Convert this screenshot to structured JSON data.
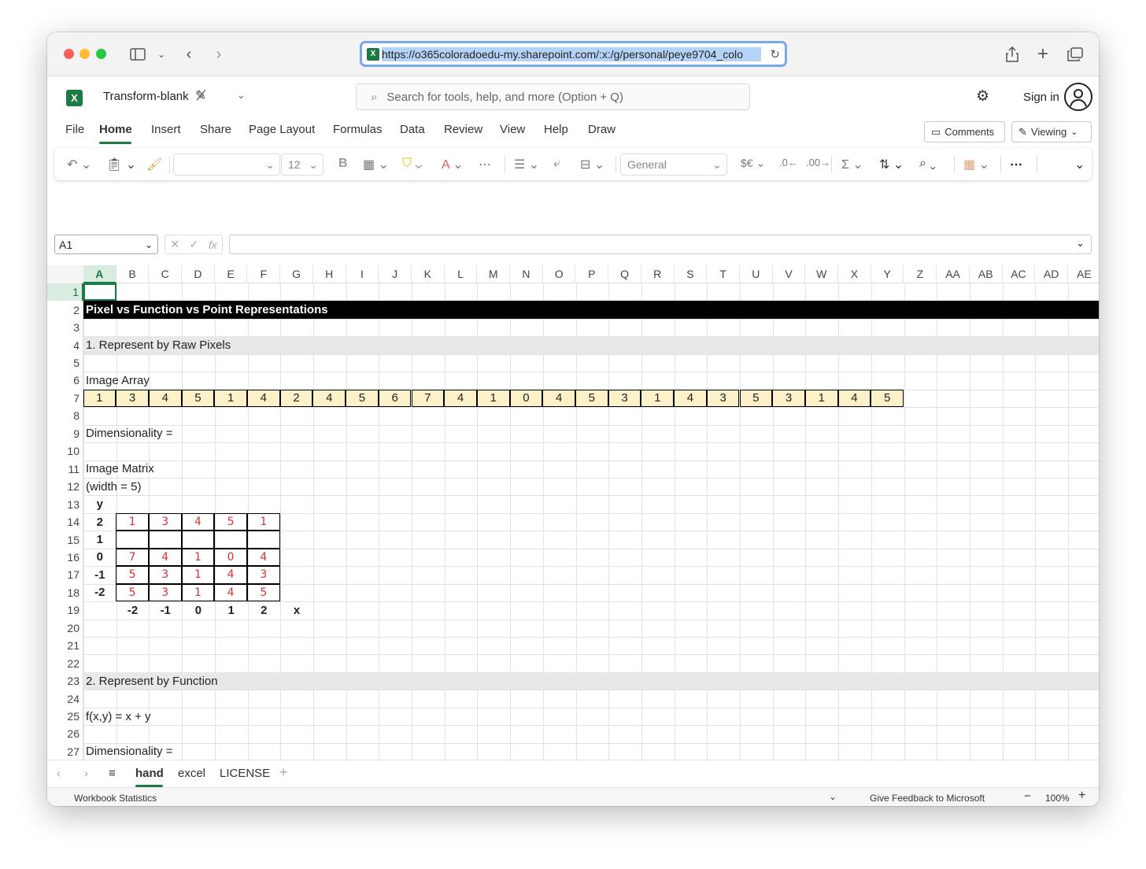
{
  "browser": {
    "url": "https://o365coloradoedu-my.sharepoint.com/:x:/g/personal/peye9704_colo"
  },
  "app": {
    "doc_name": "Transform-blank",
    "search_placeholder": "Search for tools, help, and more (Option + Q)",
    "sign_in": "Sign in",
    "comments": "Comments",
    "viewing": "Viewing"
  },
  "menu": [
    "File",
    "Home",
    "Insert",
    "Share",
    "Page Layout",
    "Formulas",
    "Data",
    "Review",
    "View",
    "Help",
    "Draw"
  ],
  "ribbon": {
    "font_size": "12",
    "number_format": "General"
  },
  "formula_bar": {
    "name_box": "A1",
    "formula": ""
  },
  "columns": [
    "A",
    "B",
    "C",
    "D",
    "E",
    "F",
    "G",
    "H",
    "I",
    "J",
    "K",
    "L",
    "M",
    "N",
    "O",
    "P",
    "Q",
    "R",
    "S",
    "T",
    "U",
    "V",
    "W",
    "X",
    "Y",
    "Z",
    "AA",
    "AB",
    "AC",
    "AD",
    "AE"
  ],
  "rows": [
    "1",
    "2",
    "3",
    "4",
    "5",
    "6",
    "7",
    "8",
    "9",
    "10",
    "11",
    "12",
    "13",
    "14",
    "15",
    "16",
    "17",
    "18",
    "19",
    "20",
    "21",
    "22",
    "23",
    "24",
    "25",
    "26",
    "27"
  ],
  "sheet": {
    "title": "Pixel vs Function vs Point Representations",
    "section1": "1. Represent by Raw Pixels",
    "image_array_label": "Image Array",
    "image_array": [
      "1",
      "3",
      "4",
      "5",
      "1",
      "4",
      "2",
      "4",
      "5",
      "6",
      "7",
      "4",
      "1",
      "0",
      "4",
      "5",
      "3",
      "1",
      "4",
      "3",
      "5",
      "3",
      "1",
      "4",
      "5"
    ],
    "dimensionality_1": "Dimensionality =",
    "image_matrix_label": "Image Matrix",
    "width_label": "(width = 5)",
    "y_label": "y",
    "y_values": [
      "2",
      "1",
      "0",
      "-1",
      "-2"
    ],
    "matrix": [
      [
        "1",
        "3",
        "4",
        "5",
        "1"
      ],
      [
        "",
        "",
        "",
        "",
        ""
      ],
      [
        "7",
        "4",
        "1",
        "0",
        "4"
      ],
      [
        "5",
        "3",
        "1",
        "4",
        "3"
      ],
      [
        "5",
        "3",
        "1",
        "4",
        "5"
      ]
    ],
    "x_values": [
      "-2",
      "-1",
      "0",
      "1",
      "2"
    ],
    "x_label": "x",
    "section2": "2. Represent by Function",
    "function": "f(x,y) = x + y",
    "dimensionality_2": "Dimensionality ="
  },
  "tabs": [
    "hand",
    "excel",
    "LICENSE"
  ],
  "status": {
    "left": "Workbook Statistics",
    "feedback": "Give Feedback to Microsoft",
    "zoom": "100%"
  },
  "colors": {
    "excel_green": "#1d7a45",
    "array_fill": "#fdf1c9",
    "title_fill": "#000000",
    "section_fill": "#e8e8e8",
    "handwriting": "#e03030"
  }
}
